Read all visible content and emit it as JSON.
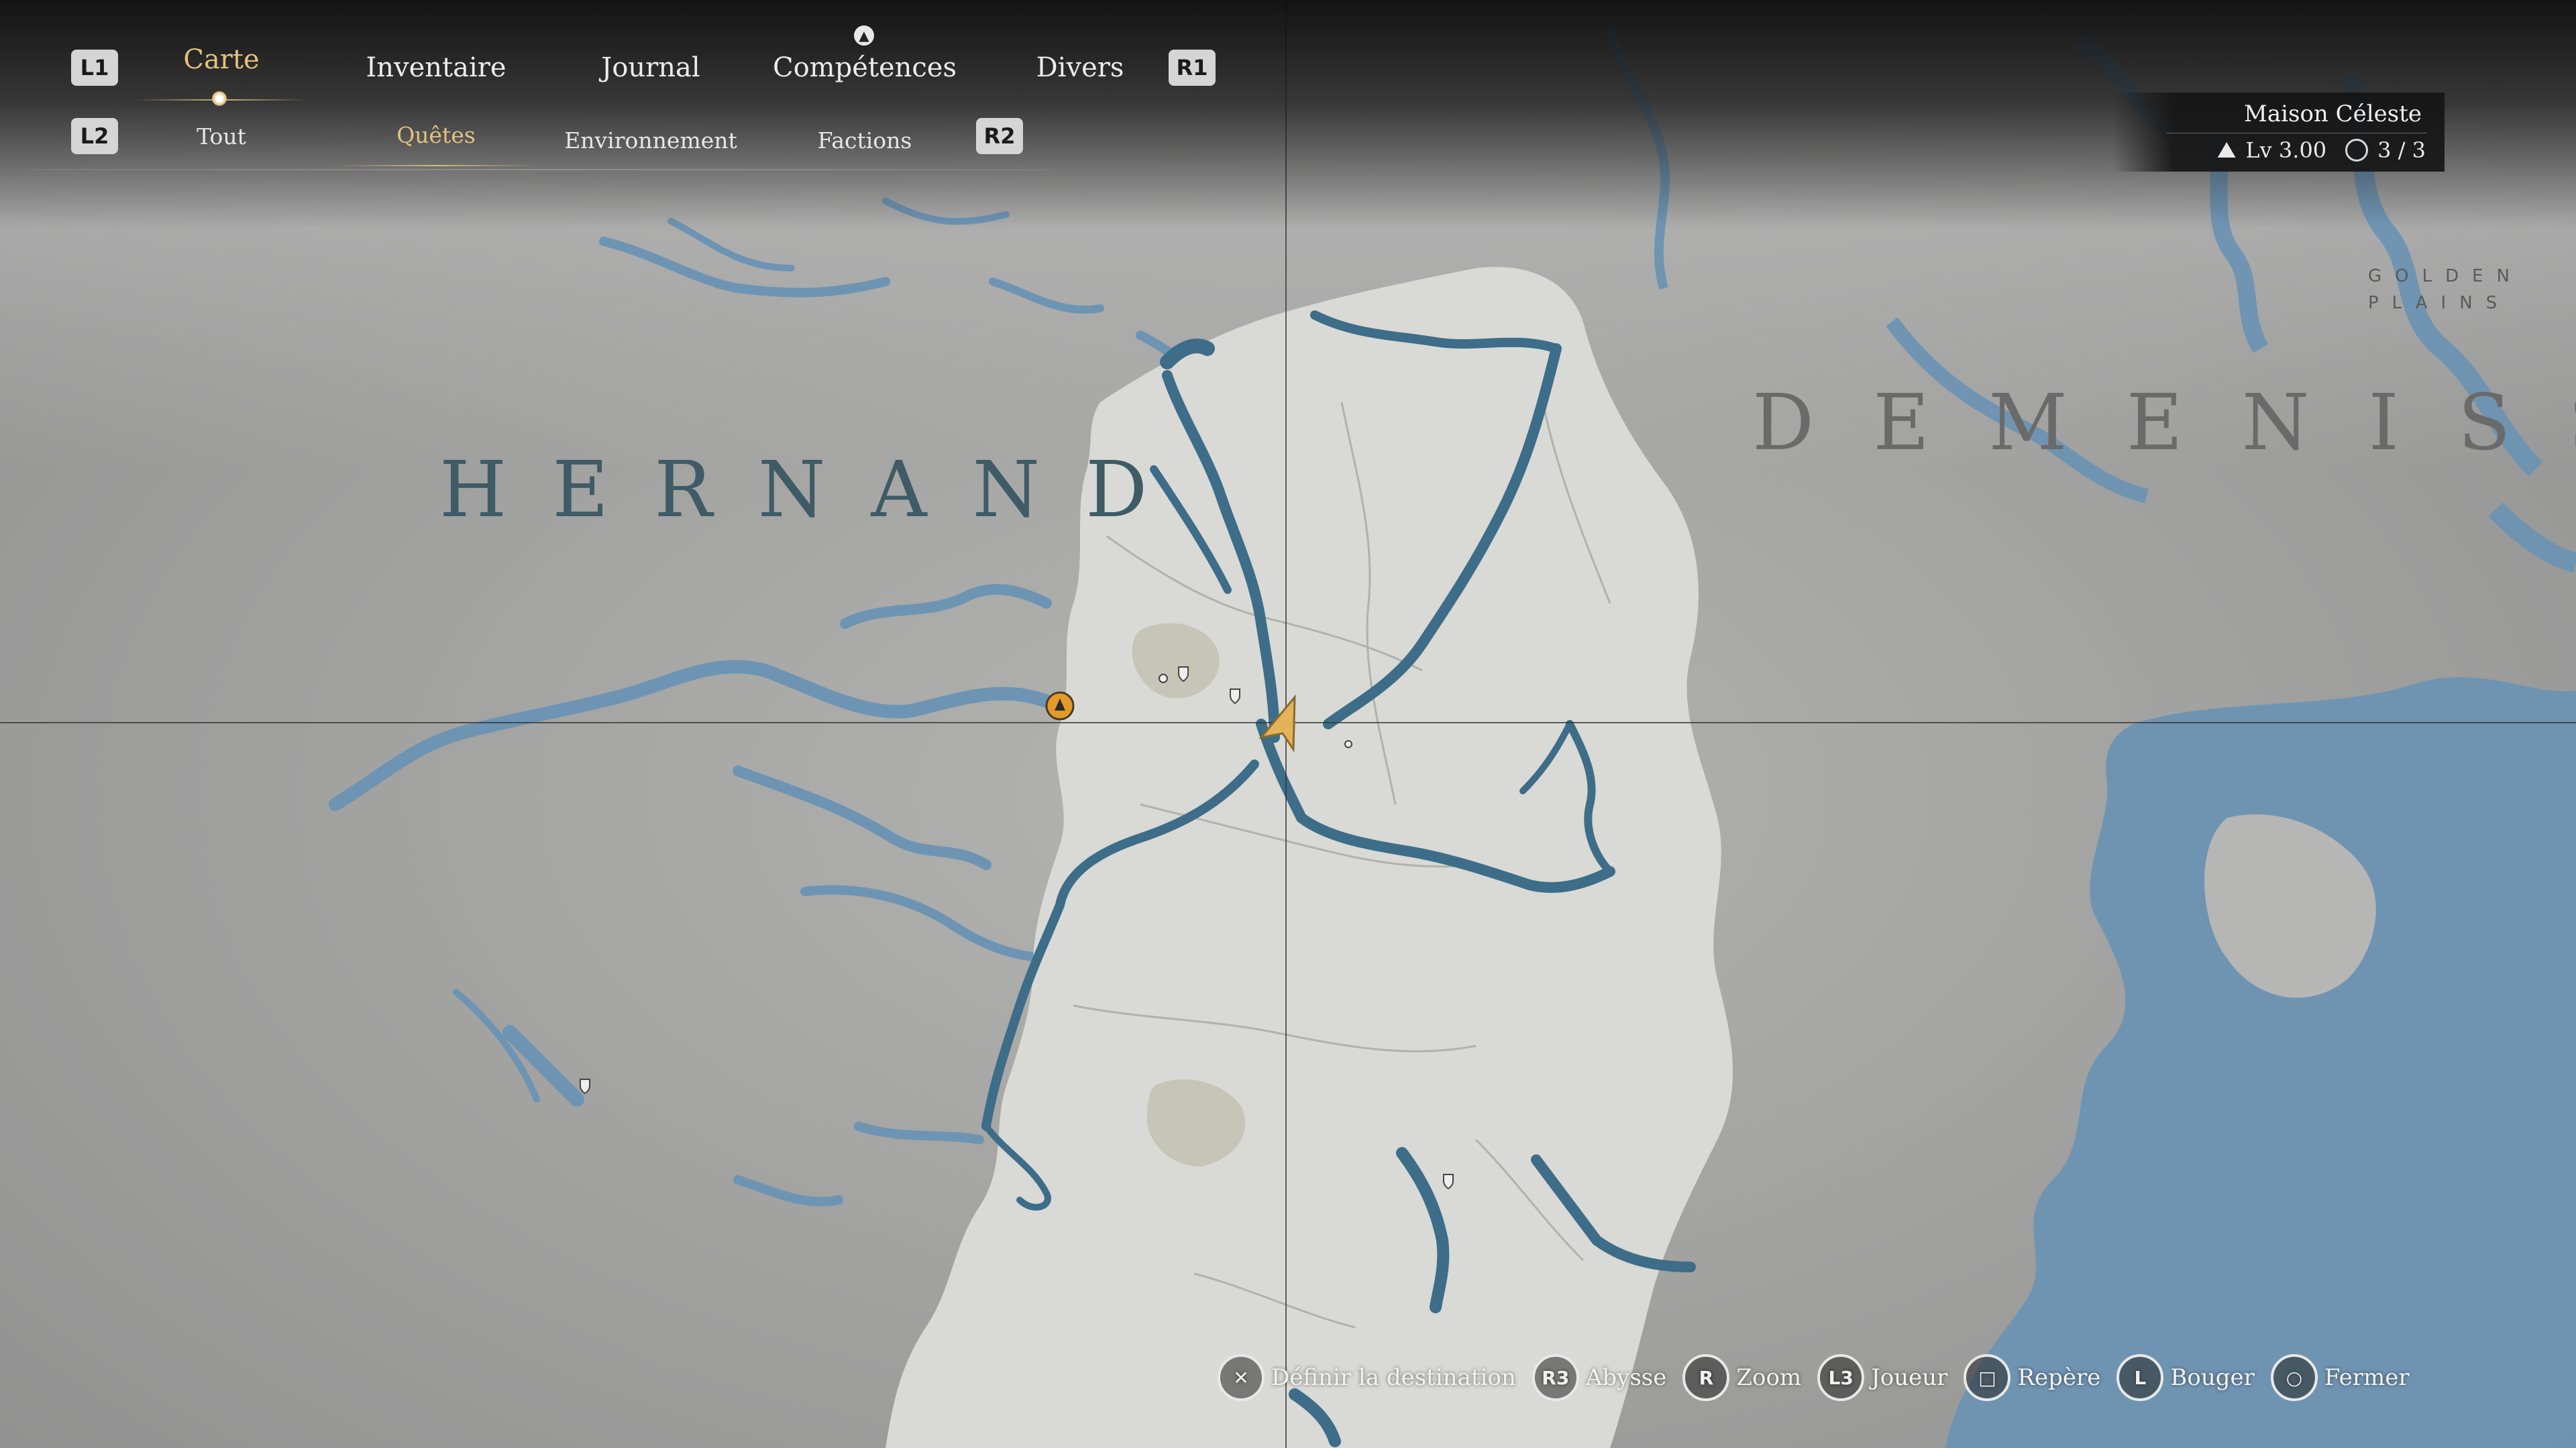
{
  "menu": {
    "shoulder_left_top": "L1",
    "shoulder_right_top": "R1",
    "shoulder_left_bottom": "L2",
    "shoulder_right_bottom": "R2",
    "tabs": [
      {
        "label": "Carte",
        "active": true
      },
      {
        "label": "Inventaire",
        "active": false
      },
      {
        "label": "Journal",
        "active": false
      },
      {
        "label": "Compétences",
        "active": false
      },
      {
        "label": "Divers",
        "active": false
      }
    ],
    "subtabs": [
      {
        "label": "Tout",
        "active": false
      },
      {
        "label": "Quêtes",
        "active": true
      },
      {
        "label": "Environnement",
        "active": false
      },
      {
        "label": "Factions",
        "active": false
      }
    ]
  },
  "location": {
    "name": "Maison Céleste",
    "level_label": "Lv 3.00",
    "count_label": "3 / 3"
  },
  "map": {
    "region_hernand": "HERNAND",
    "region_demeniss": "DEMENISS",
    "region_golden_plains_1": "GOLDEN",
    "region_golden_plains_2": "PLAINS"
  },
  "prompts": [
    {
      "button": "✕",
      "label": "Définir la destination",
      "icon": "cross-button-icon"
    },
    {
      "button": "R3",
      "label": "Abysse",
      "icon": "r3-button-icon"
    },
    {
      "button": "R",
      "label": "Zoom",
      "icon": "right-stick-icon"
    },
    {
      "button": "L3",
      "label": "Joueur",
      "icon": "l3-button-icon"
    },
    {
      "button": "□",
      "label": "Repère",
      "icon": "square-button-icon"
    },
    {
      "button": "L",
      "label": "Bouger",
      "icon": "left-stick-icon"
    },
    {
      "button": "○",
      "label": "Fermer",
      "icon": "circle-button-icon"
    }
  ],
  "colors": {
    "water": "#6d94b3",
    "river": "#3d6d88",
    "fog": "#9c9c9c",
    "land": "#dcdcd8",
    "accent": "#e3c27f",
    "player_marker": "#e39a28"
  }
}
